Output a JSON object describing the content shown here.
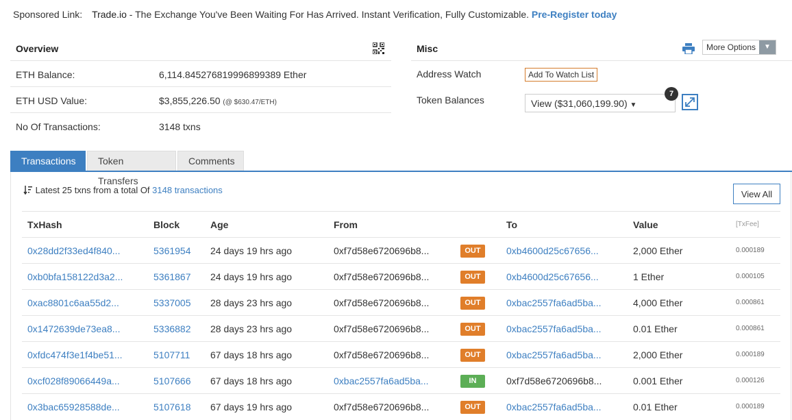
{
  "sponsor": {
    "label": "Sponsored Link:",
    "brand": "Trade.io",
    "text": " - The Exchange You've Been Waiting For Has Arrived. Instant Verification, Fully Customizable. ",
    "cta": "Pre-Register today"
  },
  "overview": {
    "title": "Overview",
    "rows": [
      {
        "label": "ETH Balance:",
        "value": "6,114.845276819996899389 Ether",
        "note": ""
      },
      {
        "label": "ETH USD Value:",
        "value": "$3,855,226.50",
        "note": "(@ $630.47/ETH)"
      },
      {
        "label": "No Of Transactions:",
        "value": "3148 txns",
        "note": ""
      }
    ]
  },
  "misc": {
    "title": "Misc",
    "more_options": "More Options",
    "address_watch_label": "Address Watch",
    "watch_button": "Add To Watch List",
    "token_balances_label": "Token Balances",
    "token_select": "View ($31,060,199.90)",
    "token_count": "7"
  },
  "tabs": [
    "Transactions",
    "Token Transfers",
    "Comments"
  ],
  "summary": {
    "prefix": "Latest 25 txns from a total Of ",
    "link": "3148 transactions",
    "view_all": "View All"
  },
  "table": {
    "headers": [
      "TxHash",
      "Block",
      "Age",
      "From",
      "",
      "To",
      "Value",
      "[TxFee]"
    ],
    "rows": [
      {
        "hash": "0x28dd2f33ed4f840...",
        "block": "5361954",
        "age": "24 days 19 hrs ago",
        "from": "0xf7d58e6720696b8...",
        "dir": "OUT",
        "to": "0xb4600d25c67656...",
        "value": "2,000 Ether",
        "fee": "0.000189"
      },
      {
        "hash": "0xb0bfa158122d3a2...",
        "block": "5361867",
        "age": "24 days 19 hrs ago",
        "from": "0xf7d58e6720696b8...",
        "dir": "OUT",
        "to": "0xb4600d25c67656...",
        "value": "1 Ether",
        "fee": "0.000105"
      },
      {
        "hash": "0xac8801c6aa55d2...",
        "block": "5337005",
        "age": "28 days 23 hrs ago",
        "from": "0xf7d58e6720696b8...",
        "dir": "OUT",
        "to": "0xbac2557fa6ad5ba...",
        "value": "4,000 Ether",
        "fee": "0.000861"
      },
      {
        "hash": "0x1472639de73ea8...",
        "block": "5336882",
        "age": "28 days 23 hrs ago",
        "from": "0xf7d58e6720696b8...",
        "dir": "OUT",
        "to": "0xbac2557fa6ad5ba...",
        "value": "0.01 Ether",
        "fee": "0.000861"
      },
      {
        "hash": "0xfdc474f3e1f4be51...",
        "block": "5107711",
        "age": "67 days 18 hrs ago",
        "from": "0xf7d58e6720696b8...",
        "dir": "OUT",
        "to": "0xbac2557fa6ad5ba...",
        "value": "2,000 Ether",
        "fee": "0.000189"
      },
      {
        "hash": "0xcf028f89066449a...",
        "block": "5107666",
        "age": "67 days 18 hrs ago",
        "from": "0xbac2557fa6ad5ba...",
        "dir": "IN",
        "to": "0xf7d58e6720696b8...",
        "value": "0.001 Ether",
        "fee": "0.000126"
      },
      {
        "hash": "0x3bac65928588de...",
        "block": "5107618",
        "age": "67 days 19 hrs ago",
        "from": "0xf7d58e6720696b8...",
        "dir": "OUT",
        "to": "0xbac2557fa6ad5ba...",
        "value": "0.01 Ether",
        "fee": "0.000189"
      }
    ]
  },
  "icons": {
    "qr": "qr-code-icon",
    "print": "printer-icon",
    "expand": "expand-icon",
    "sort": "sort-icon",
    "caret": "chevron-down-icon"
  },
  "colors": {
    "link": "#3d7fc1",
    "out_badge": "#e07e2a",
    "in_badge": "#5cae56",
    "watch_border": "#d47b2a"
  }
}
